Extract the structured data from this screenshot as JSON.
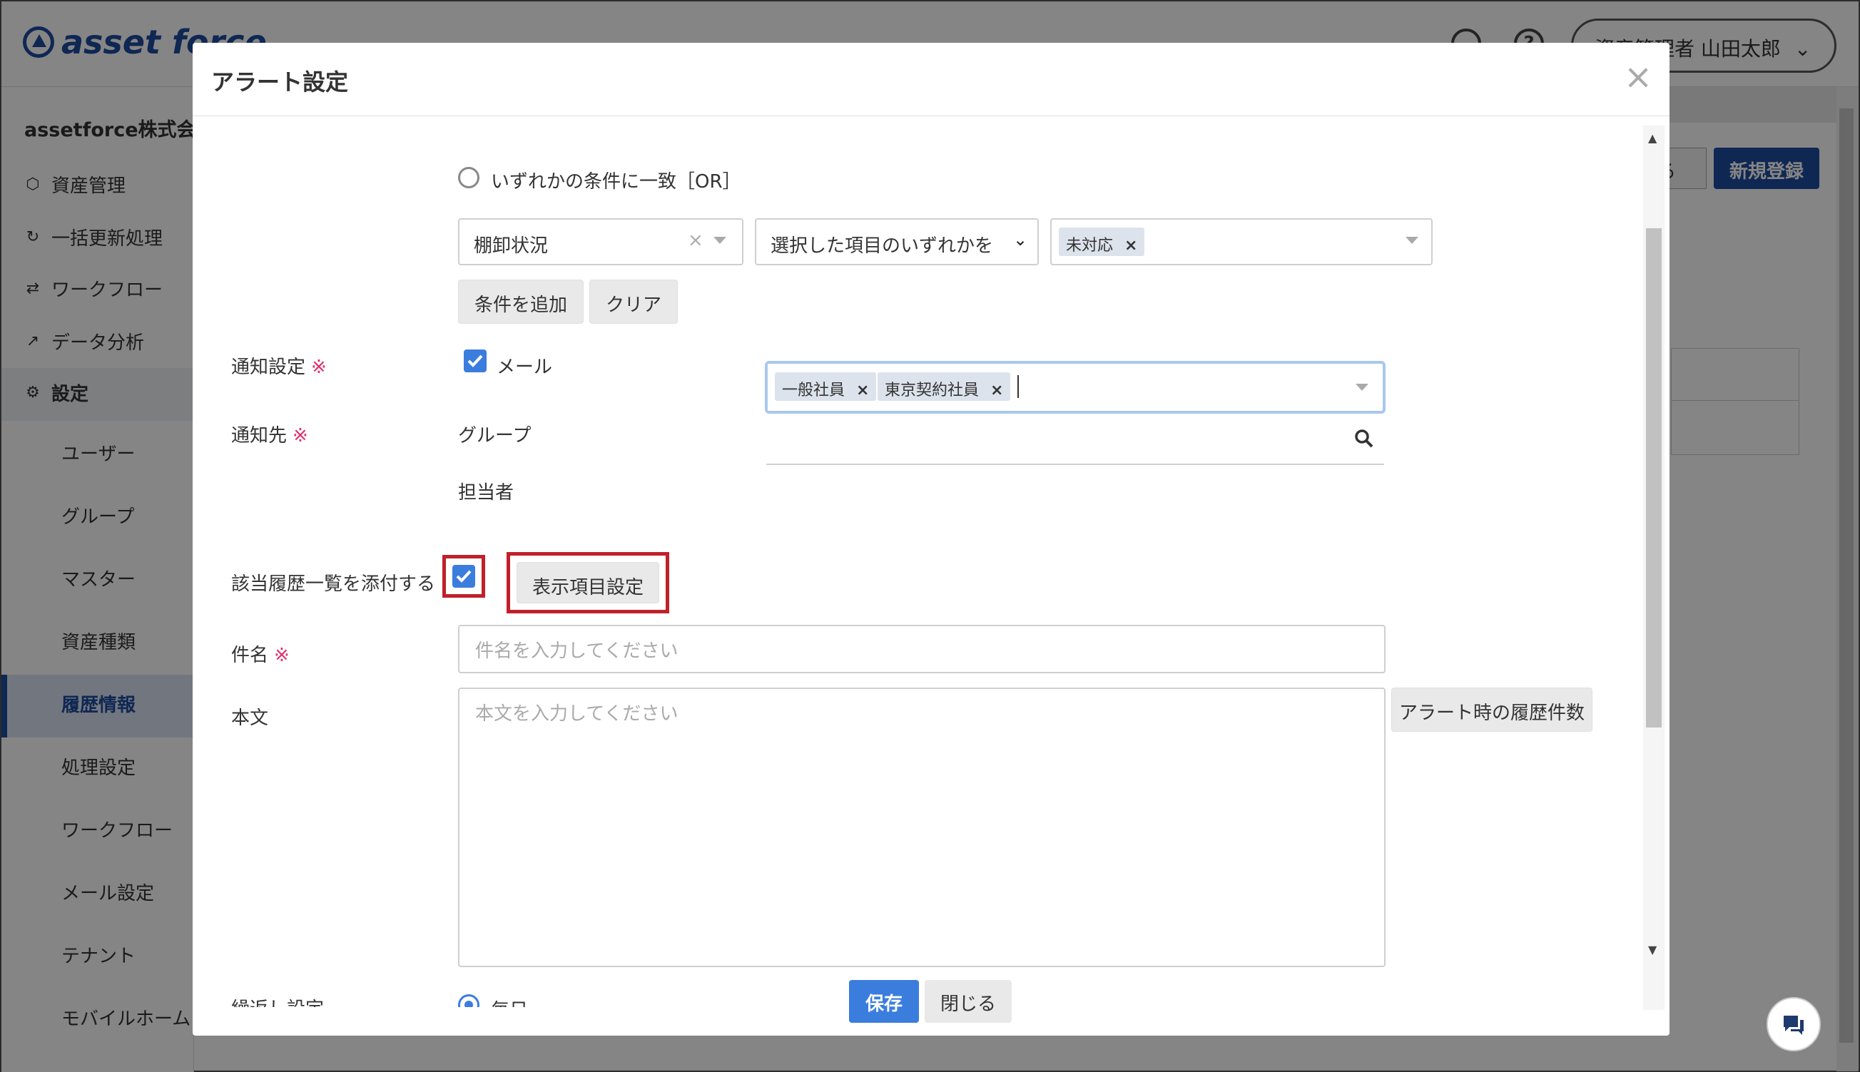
{
  "app": {
    "logo_text": "asset force",
    "user_label": "資産管理者 山田太郎",
    "company": "assetforce株式会社",
    "nav": [
      {
        "label": "資産管理",
        "icon": "cube-icon"
      },
      {
        "label": "一括更新処理",
        "icon": "refresh-icon"
      },
      {
        "label": "ワークフロー",
        "icon": "workflow-icon"
      },
      {
        "label": "データ分析",
        "icon": "chart-icon"
      },
      {
        "label": "設定",
        "icon": "gear-icon"
      }
    ],
    "subnav": [
      "ユーザー",
      "グループ",
      "マスター",
      "資産種類",
      "履歴情報",
      "処理設定",
      "ワークフロー",
      "メール設定",
      "テナント",
      "モバイルホーム"
    ],
    "active_subnav": "履歴情報",
    "partial_button": "る",
    "new_button": "新規登録"
  },
  "modal": {
    "title": "アラート設定",
    "close_icon": "×",
    "condition": {
      "or_radio_label": "いずれかの条件に一致［OR］",
      "field_select": "棚卸状況",
      "operator_select": "選択した項目のいずれかを含む",
      "value_tag": "未対応",
      "add_button": "条件を追加",
      "clear_button": "クリア"
    },
    "notify": {
      "label": "通知設定",
      "required_mark": "※",
      "mail_label": "メール",
      "mail_checked": true
    },
    "recipients": {
      "label": "通知先",
      "required_mark": "※",
      "group_label": "グループ",
      "group_tags": [
        "一般社員",
        "東京契約社員"
      ],
      "person_label": "担当者"
    },
    "attach": {
      "label": "該当履歴一覧を添付する",
      "checked": true,
      "display_button": "表示項目設定"
    },
    "subject": {
      "label": "件名",
      "required_mark": "※",
      "placeholder": "件名を入力してください"
    },
    "body": {
      "label": "本文",
      "placeholder": "本文を入力してください",
      "insert_button": "アラート時の履歴件数"
    },
    "repeat": {
      "label": "繰返し設定",
      "option": "毎日"
    },
    "save_button": "保存",
    "cancel_button": "閉じる"
  },
  "colors": {
    "primary": "#3b7ddd",
    "brand": "#1e4ba0",
    "required": "#e0306a",
    "highlight": "#c0202a"
  }
}
